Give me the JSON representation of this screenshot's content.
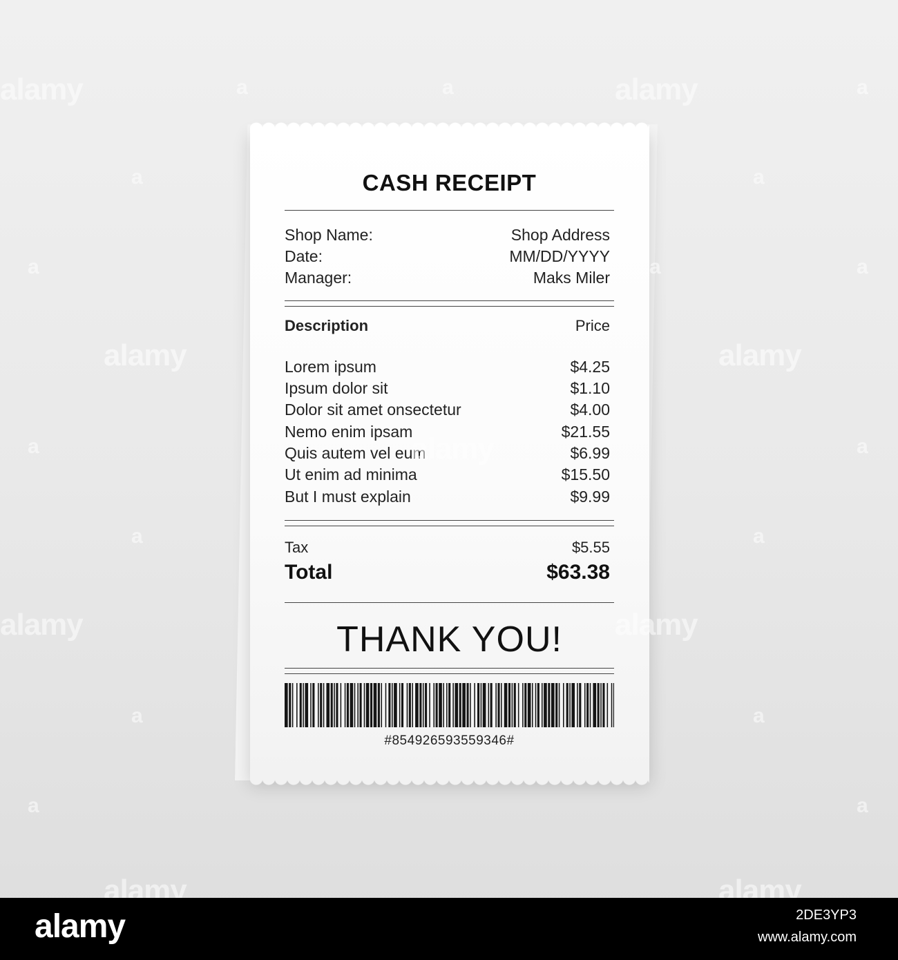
{
  "receipt": {
    "title": "CASH RECEIPT",
    "info": [
      {
        "label": "Shop Name:",
        "value": "Shop Address"
      },
      {
        "label": "Date:",
        "value": "MM/DD/YYYY"
      },
      {
        "label": "Manager:",
        "value": "Maks Miler"
      }
    ],
    "header": {
      "description": "Description",
      "price": "Price"
    },
    "items": [
      {
        "name": "Lorem ipsum",
        "price": "$4.25"
      },
      {
        "name": "Ipsum dolor sit",
        "price": "$1.10"
      },
      {
        "name": "Dolor sit amet onsectetur",
        "price": "$4.00"
      },
      {
        "name": "Nemo enim ipsam",
        "price": "$21.55"
      },
      {
        "name": "Quis autem vel eum",
        "price": "$6.99"
      },
      {
        "name": "Ut enim ad minima",
        "price": "$15.50"
      },
      {
        "name": "But I must explain",
        "price": "$9.99"
      }
    ],
    "tax": {
      "label": "Tax",
      "value": "$5.55"
    },
    "total": {
      "label": "Total",
      "value": "$63.38"
    },
    "thanks": "THANK YOU!",
    "barcode_number": "#854926593559346#"
  },
  "watermark": {
    "text": "alamy",
    "short": "a"
  },
  "footer": {
    "logo": "alamy",
    "image_id": "2DE3YP3",
    "url": "www.alamy.com"
  },
  "colors": {
    "background": "#e9e9e9",
    "paper": "#ffffff",
    "ink": "#1a1a1a",
    "strip": "#000000"
  }
}
